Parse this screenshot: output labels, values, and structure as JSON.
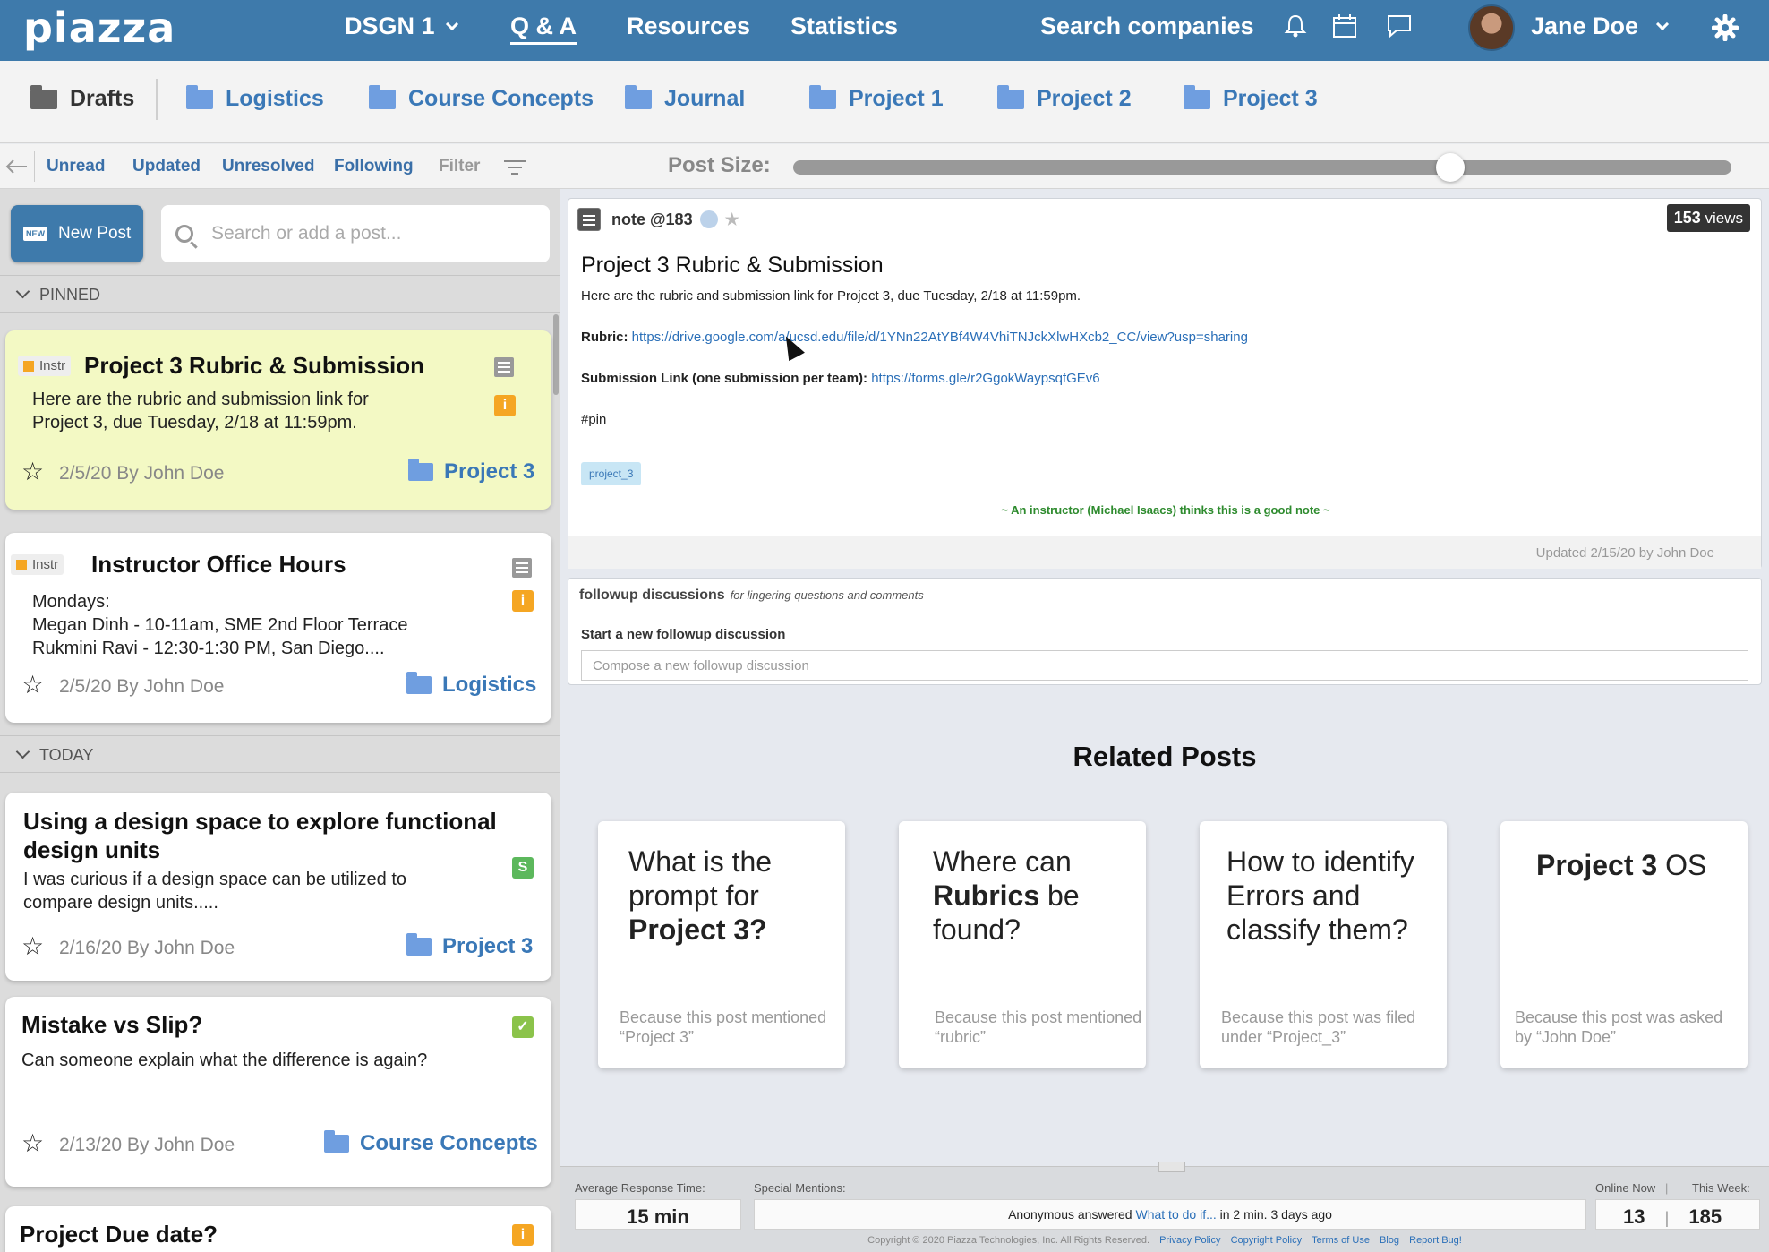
{
  "nav": {
    "logo": "piazza",
    "course": "DSGN 1",
    "qa": "Q & A",
    "resources": "Resources",
    "statistics": "Statistics",
    "search_companies": "Search companies",
    "user_name": "Jane Doe"
  },
  "folders": {
    "drafts": "Drafts",
    "items": [
      "Logistics",
      "Course Concepts",
      "Journal",
      "Project 1",
      "Project 2",
      "Project 3"
    ]
  },
  "filters": {
    "unread": "Unread",
    "updated": "Updated",
    "unresolved": "Unresolved",
    "following": "Following",
    "filter": "Filter",
    "post_size_label": "Post Size:",
    "post_size_value": 0.7
  },
  "feed": {
    "new_post": "New Post",
    "new_tag": "NEW",
    "search_placeholder": "Search or add a post...",
    "pinned_label": "PINNED",
    "today_label": "TODAY",
    "instr_label": "Instr",
    "pinned": [
      {
        "title": "Project 3 Rubric & Submission",
        "body": [
          "Here are the rubric and submission link for",
          "Project 3, due Tuesday, 2/18 at 11:59pm."
        ],
        "meta": "2/5/20 By John Doe",
        "folder": "Project 3"
      },
      {
        "title": "Instructor Office Hours",
        "body": [
          "Mondays:",
          "Megan Dinh - 10-11am, SME 2nd Floor Terrace",
          "Rukmini Ravi - 12:30-1:30 PM, San Diego...."
        ],
        "meta": "2/5/20 By John Doe",
        "folder": "Logistics"
      }
    ],
    "today": [
      {
        "title": [
          "Using a design space to explore functional",
          "design units"
        ],
        "body": [
          "I was curious if a design space can be utilized to",
          "compare design units....."
        ],
        "meta": "2/16/20 By John Doe",
        "folder": "Project 3",
        "badge": "S"
      },
      {
        "title": "Mistake vs Slip?",
        "body": "Can someone explain what the difference is again?",
        "meta": "2/13/20 By John Doe",
        "folder": "Course Concepts"
      },
      {
        "title": "Project Due date?",
        "badge": "i"
      }
    ],
    "badge_i": "i"
  },
  "note": {
    "label": "note @183",
    "views_count": "153",
    "views_word": "views",
    "title": "Project 3 Rubric & Submission",
    "intro": "Here are the rubric and submission link for Project 3, due Tuesday, 2/18 at 11:59pm.",
    "rubric_label": "Rubric:",
    "rubric_url": "https://drive.google.com/a/ucsd.edu/file/d/1YNn22AtYBf4W4VhiTNJckXlwHXcb2_CC/view?usp=sharing",
    "submission_label": "Submission Link (one submission per team):",
    "submission_url": "https://forms.gle/r2GgokWaypsqfGEv6",
    "hashtag": "#pin",
    "tag": "project_3",
    "good_note": "~ An instructor (Michael Isaacs) thinks this is a good note ~",
    "updated": "Updated 2/15/20 by John Doe"
  },
  "followup": {
    "header": "followup discussions",
    "subheader": "for lingering questions and comments",
    "start_label": "Start a new followup discussion",
    "placeholder": "Compose a new followup discussion"
  },
  "related": {
    "title": "Related Posts",
    "cards": [
      {
        "q_pre": "What is the prompt for",
        "q_bold": "Project 3?",
        "q_post": "",
        "why": "Because this post mentioned “Project 3”"
      },
      {
        "q_pre": "Where can",
        "q_bold": "Rubrics",
        "q_post": "be found?",
        "why": "Because this post mentioned “rubric”"
      },
      {
        "q_pre": "How to identify Errors and classify them?",
        "q_bold": "",
        "q_post": "",
        "why": "Because this post was filed under “Project_3”"
      },
      {
        "q_pre": "",
        "q_bold": "Project 3",
        "q_post": "OS",
        "why": "Because this post was asked by “John Doe”"
      }
    ]
  },
  "footer": {
    "avg_label": "Average Response Time:",
    "avg_value": "15 min",
    "mentions_label": "Special Mentions:",
    "mention_pre": "Anonymous answered",
    "mention_link": "What to do if...",
    "mention_post": "in 2 min. 3 days ago",
    "online_label": "Online Now",
    "week_label": "This Week:",
    "online_value": "13",
    "week_value": "185",
    "copyright": "Copyright © 2020 Piazza Technologies, Inc. All Rights Reserved.",
    "links": [
      "Privacy Policy",
      "Copyright Policy",
      "Terms of Use",
      "Blog",
      "Report Bug!"
    ]
  },
  "colors": {
    "brand": "#3e7aab",
    "link": "#2a6fb8",
    "folder": "#6f9ee0",
    "pinned_highlight": "#f3f9c4",
    "good_note": "#2e8b2e",
    "instr_badge": "#f5a623"
  }
}
